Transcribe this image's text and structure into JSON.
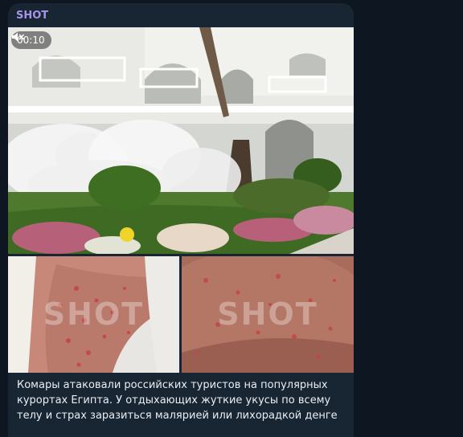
{
  "channel": {
    "name": "SHOT",
    "name_color": "#a695e7"
  },
  "video": {
    "duration": "00:10",
    "muted": true,
    "mute_icon": "speaker-muted-icon"
  },
  "photos": [
    {
      "watermark": "SHOT"
    },
    {
      "watermark": "SHOT"
    }
  ],
  "message": {
    "text": "Комары атаковали российских туристов на популярных курортах Египта. У отдыхающих жуткие укусы по всему телу и страх заразиться малярией или лихорадкой денге"
  },
  "colors": {
    "background": "#0e1621",
    "bubble": "#182533",
    "text": "#e9eef3"
  }
}
